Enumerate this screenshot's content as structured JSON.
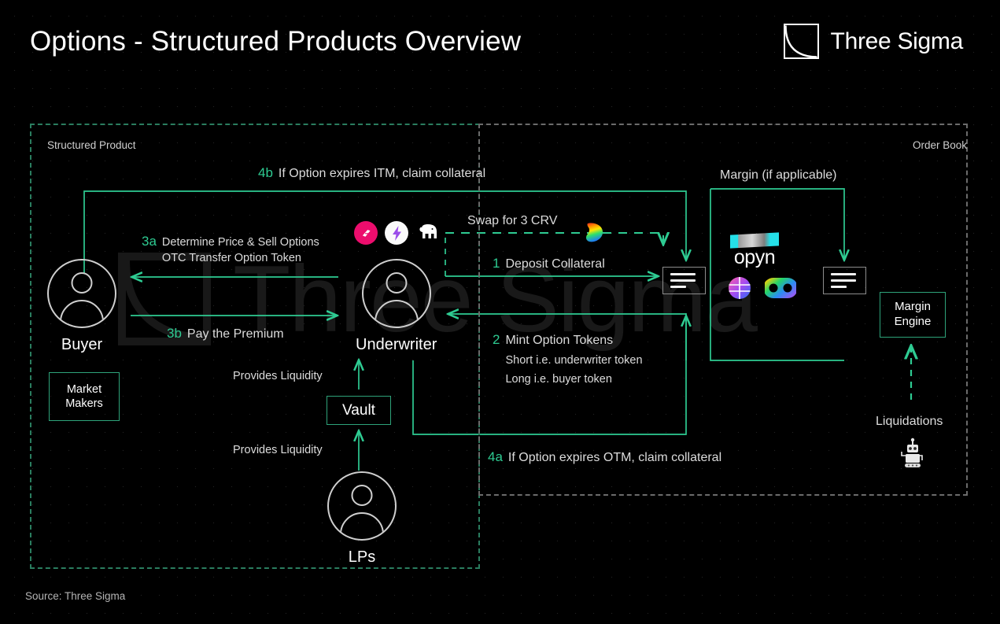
{
  "header": {
    "title": "Options - Structured Products Overview",
    "logo_text": "Three Sigma",
    "logo_icon": "three-sigma-square-curve-logo"
  },
  "watermark": {
    "text": "Three Sigma"
  },
  "zones": {
    "structured_product": {
      "label": "Structured Product",
      "border_color": "#2a7d5f",
      "border_style": "dashed"
    },
    "order_book": {
      "label": "Order Book",
      "border_color": "#6b6b6b",
      "border_style": "dashed"
    }
  },
  "actors": {
    "buyer": {
      "label": "Buyer",
      "icon": "user-avatar-icon"
    },
    "underwriter": {
      "label": "Underwriter",
      "icon": "user-avatar-icon"
    },
    "lps": {
      "label": "LPs",
      "icon": "user-avatar-icon"
    }
  },
  "boxes": {
    "market_makers": {
      "line1": "Market",
      "line2": "Makers"
    },
    "vault": {
      "label": "Vault"
    },
    "margin_engine": {
      "line1": "Margin",
      "line2": "Engine"
    }
  },
  "flows": {
    "step_4b": {
      "num": "4b",
      "text": "If Option expires ITM, claim collateral"
    },
    "step_3a": {
      "num": "3a",
      "line1": "Determine Price & Sell Options",
      "line2": "OTC Transfer Option Token"
    },
    "step_3b": {
      "num": "3b",
      "text": "Pay the Premium"
    },
    "swap": {
      "text": "Swap for  3 CRV"
    },
    "step_1": {
      "num": "1",
      "text": "Deposit Collateral"
    },
    "step_2": {
      "num": "2",
      "line1": "Mint Option Tokens",
      "line2": "Short i.e. underwriter token",
      "line3": "Long i.e. buyer token"
    },
    "provides_liquidity_1": {
      "text": "Provides Liquidity"
    },
    "provides_liquidity_2": {
      "text": "Provides Liquidity"
    },
    "step_4a": {
      "num": "4a",
      "text": "If Option expires OTM, claim collateral"
    },
    "margin": {
      "text": "Margin (if applicable)"
    },
    "liquidations": {
      "text": "Liquidations",
      "icon": "robot-icon"
    }
  },
  "protocols": {
    "vault_protocols": [
      {
        "name": "ribbon-finance-icon"
      },
      {
        "name": "thetanuts-lightning-icon"
      },
      {
        "name": "mammoth-icon"
      }
    ],
    "curve": {
      "name": "curve-finance-icon"
    },
    "opyn": {
      "name": "opyn-logo",
      "word": "opyn"
    },
    "opyn_row": [
      {
        "name": "gradient-sphere-icon"
      },
      {
        "name": "rainbow-loop-icon"
      }
    ]
  },
  "icons": {
    "order_book_left": "order-book-list-icon",
    "order_book_right": "order-book-list-icon"
  },
  "colors": {
    "accent_green": "#2ecb92",
    "zone_green": "#2a7d5f",
    "zone_gray": "#6b6b6b",
    "background": "#000000",
    "text": "#e8e8e8"
  },
  "footer": {
    "source": "Source: Three Sigma"
  }
}
